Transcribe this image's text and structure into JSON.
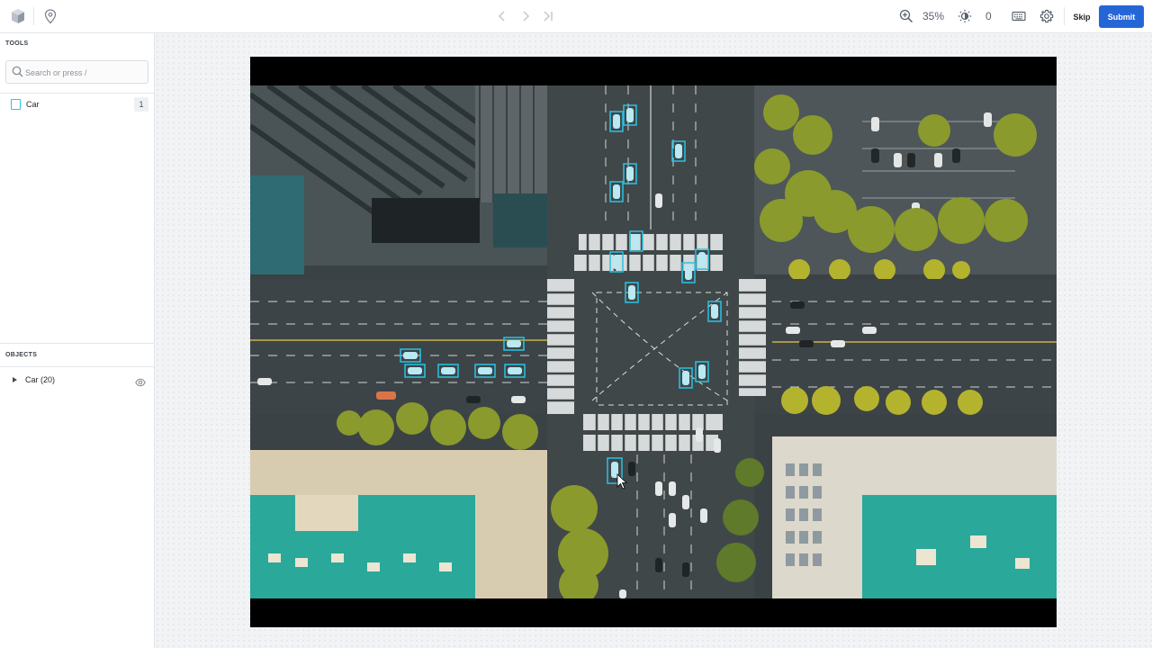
{
  "toolbar": {
    "zoom_label": "35%",
    "brightness_value": "0",
    "skip_label": "Skip",
    "submit_label": "Submit"
  },
  "tools": {
    "title": "TOOLS",
    "search_placeholder": "Search or press /",
    "items": [
      {
        "label": "Car",
        "hotkey": "1",
        "color": "#27c4e6"
      }
    ]
  },
  "objects": {
    "title": "OBJECTS",
    "groups": [
      {
        "label": "Car (20)"
      }
    ]
  },
  "colors": {
    "accent": "#2566d6",
    "annotation": "#27c4e6"
  },
  "icons": [
    "app-logo-icon",
    "location-pin-icon",
    "chevron-left-icon",
    "chevron-right-icon",
    "skip-to-end-icon",
    "zoom-in-icon",
    "brightness-icon",
    "keyboard-icon",
    "gear-icon",
    "search-icon",
    "eye-icon",
    "caret-right-icon"
  ]
}
